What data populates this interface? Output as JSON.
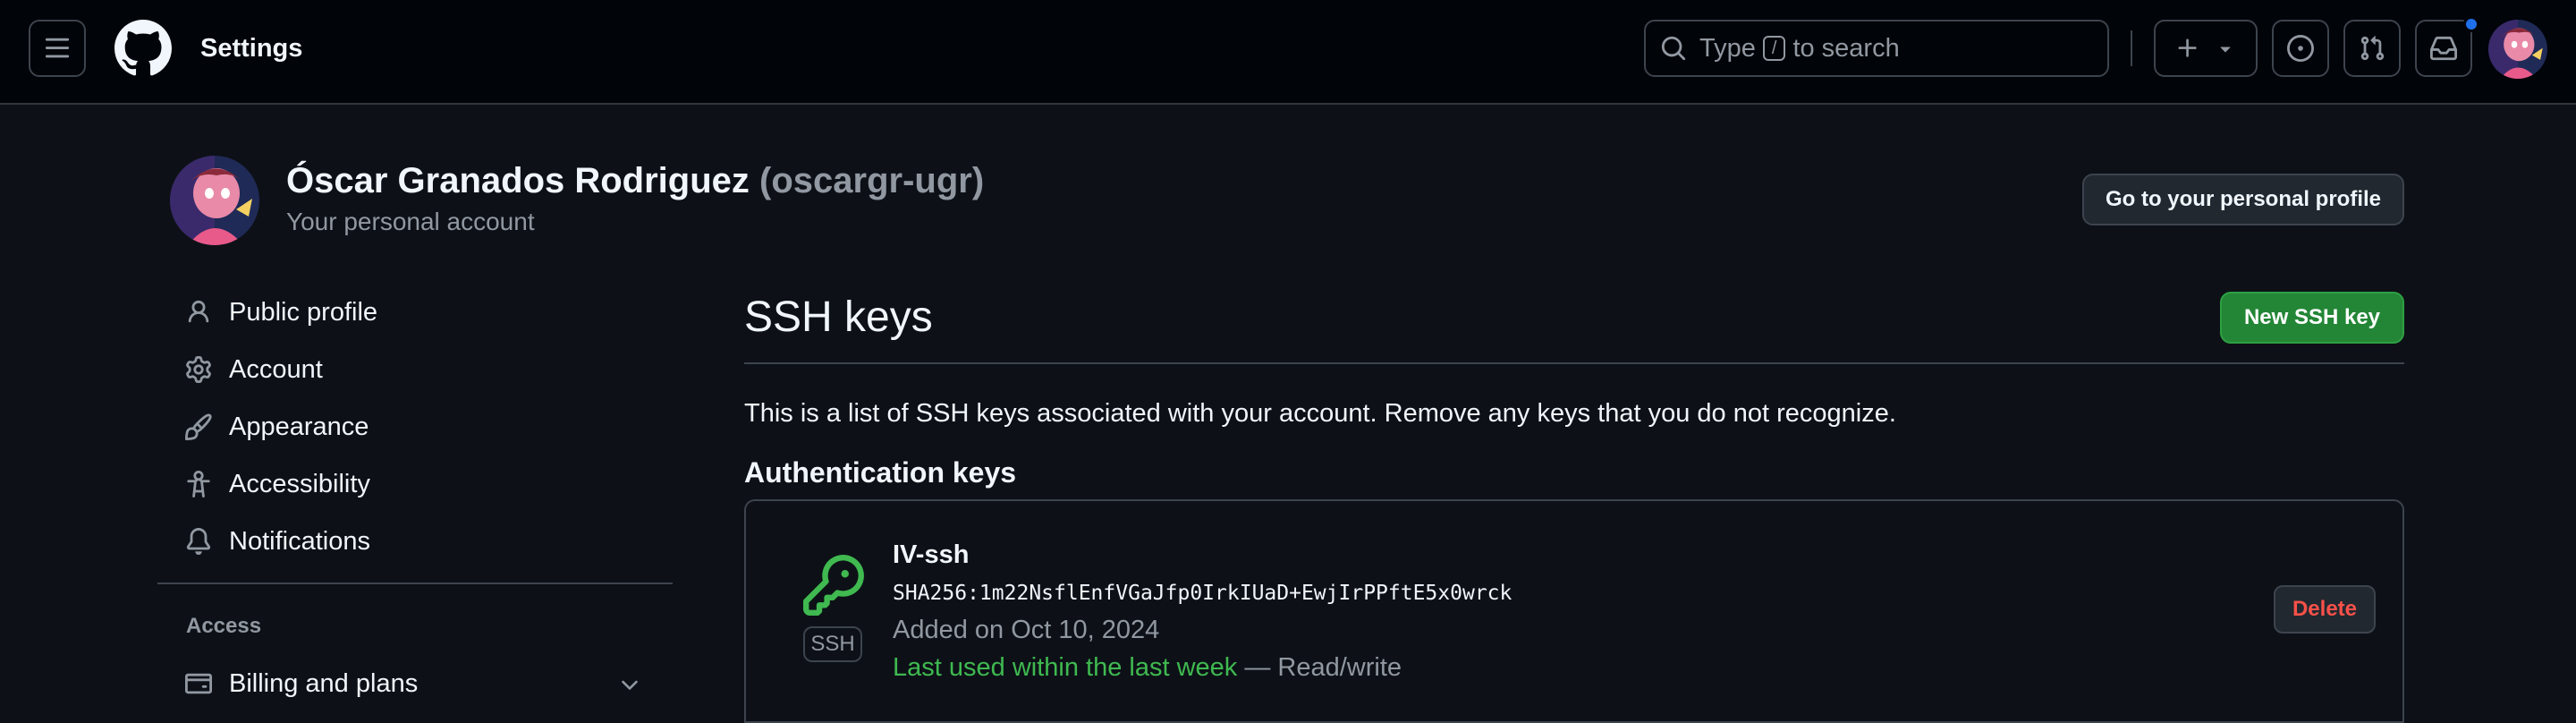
{
  "header": {
    "context_title": "Settings",
    "search_prefix": "Type",
    "search_key": "/",
    "search_suffix": "to search",
    "icons": [
      "menu-icon",
      "github-logo-icon",
      "search-icon",
      "plus-icon",
      "triangle-down-icon",
      "issue-opened-icon",
      "git-pull-request-icon",
      "inbox-icon",
      "avatar"
    ],
    "notification_color": "#1f6feb"
  },
  "profile": {
    "name": "Óscar Granados Rodriguez",
    "username": "(oscargr-ugr)",
    "subtitle": "Your personal account",
    "goto_button": "Go to your personal profile"
  },
  "sidebar": {
    "items": [
      {
        "label": "Public profile",
        "icon": "person-icon"
      },
      {
        "label": "Account",
        "icon": "gear-icon"
      },
      {
        "label": "Appearance",
        "icon": "paintbrush-icon"
      },
      {
        "label": "Accessibility",
        "icon": "accessibility-icon"
      },
      {
        "label": "Notifications",
        "icon": "bell-icon"
      }
    ],
    "access_heading": "Access",
    "billing": {
      "label": "Billing and plans",
      "icon": "credit-card-icon"
    }
  },
  "main": {
    "title": "SSH keys",
    "new_button": "New SSH key",
    "intro": "This is a list of SSH keys associated with your account. Remove any keys that you do not recognize.",
    "section_heading": "Authentication keys",
    "keys": [
      {
        "title": "IV-ssh",
        "badge": "SSH",
        "fingerprint": "SHA256:1m22NsflEnfVGaJfp0IrkIUaD+EwjIrPPftE5x0wrck",
        "added": "Added on Oct 10, 2024",
        "last_used": "Last used within the last week",
        "access": " — Read/write",
        "delete_label": "Delete"
      }
    ]
  },
  "colors": {
    "primary_button": "#238636",
    "key_icon": "#3fb950",
    "danger": "#f85149"
  }
}
